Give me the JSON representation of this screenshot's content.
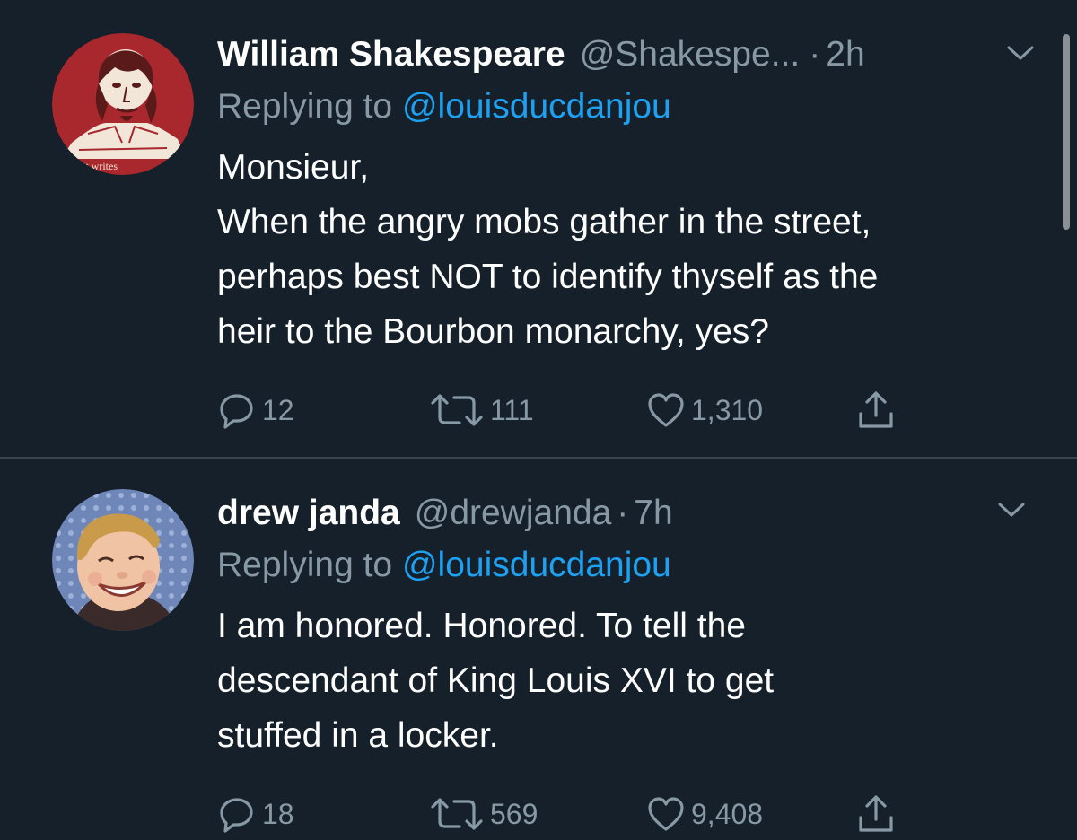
{
  "colors": {
    "background": "#15202b",
    "divider": "#38444d",
    "secondary_text": "#8899a6",
    "link": "#1da1f2",
    "primary_text": "#ffffff"
  },
  "tweets": [
    {
      "name": "William Shakespeare",
      "handle": "@Shakespe...",
      "dot": "·",
      "time": "2h",
      "reply_prefix": "Replying to ",
      "reply_to": "@louisducdanjou",
      "avatar_icon": "shakespeare-portrait-avatar",
      "avatar_text": "it writes",
      "lines": [
        "Monsieur,",
        "When the angry mobs gather in the street,",
        "perhaps best NOT to identify thyself as the",
        "heir to the Bourbon monarchy, yes?"
      ],
      "replies": "12",
      "retweets": "111",
      "likes": "1,310"
    },
    {
      "name": "drew janda",
      "handle": "@drewjanda",
      "dot": "·",
      "time": "7h",
      "reply_prefix": "Replying to ",
      "reply_to": "@louisducdanjou",
      "avatar_icon": "smiling-child-avatar",
      "lines": [
        "I am honored. Honored. To tell the",
        "descendant of King Louis XVI to get",
        "stuffed in a locker."
      ],
      "replies": "18",
      "retweets": "569",
      "likes": "9,408"
    }
  ]
}
